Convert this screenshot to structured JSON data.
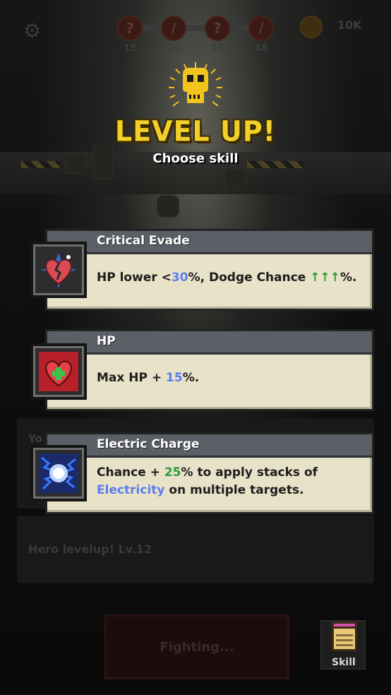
{
  "hud": {
    "stages": [
      {
        "num": "15",
        "icon": "question-icon",
        "glyph": "?"
      },
      {
        "num": "16",
        "icon": "sword-icon",
        "glyph": "/"
      },
      {
        "num": "17",
        "icon": "question-icon",
        "glyph": "?"
      },
      {
        "num": "18",
        "icon": "sword-icon",
        "glyph": "/"
      }
    ],
    "coins": "10K"
  },
  "level_up": {
    "title": "LEVEL UP!",
    "subtitle": "Choose skill"
  },
  "skills": [
    {
      "name": "Critical Evade",
      "icon": "broken-heart-icon",
      "desc_parts": [
        {
          "text": "HP lower <",
          "style": "plain"
        },
        {
          "text": "30",
          "style": "blue"
        },
        {
          "text": "%, Dodge Chance ",
          "style": "plain"
        },
        {
          "text": "↑↑↑",
          "style": "green"
        },
        {
          "text": "%.",
          "style": "plain"
        }
      ]
    },
    {
      "name": "HP",
      "icon": "heart-plus-icon",
      "desc_parts": [
        {
          "text": "Max HP + ",
          "style": "plain"
        },
        {
          "text": "15",
          "style": "blue"
        },
        {
          "text": "%.",
          "style": "plain"
        }
      ]
    },
    {
      "name": "Electric Charge",
      "icon": "electric-orb-icon",
      "desc_parts": [
        {
          "text": "Chance + ",
          "style": "plain"
        },
        {
          "text": "25",
          "style": "green"
        },
        {
          "text": "% to apply stacks of ",
          "style": "plain"
        },
        {
          "text": "Electricity",
          "style": "blue"
        },
        {
          "text": " on multiple targets.",
          "style": "plain"
        }
      ]
    }
  ],
  "background": {
    "partial_text": "Yo",
    "log_text": "Hero levelup! Lv.12",
    "fight_button": "Fighting...",
    "skill_tab_label": "Skill"
  },
  "colors": {
    "title_yellow": "#f2cf2a",
    "value_blue": "#5b7ef0",
    "value_green": "#2d9a3a",
    "card_bg": "#e8e2c8",
    "card_header": "#5b6067"
  }
}
